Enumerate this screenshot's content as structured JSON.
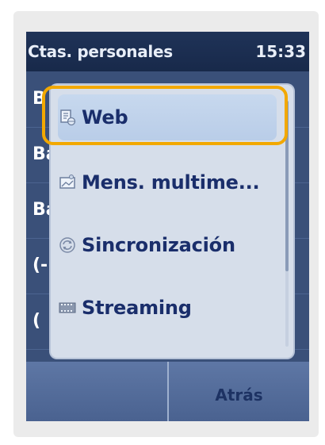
{
  "statusbar": {
    "title": "Ctas. personales",
    "time": "15:33"
  },
  "background_rows": [
    "B",
    "Ba",
    "Ba",
    "(-",
    "("
  ],
  "menu": {
    "items": [
      {
        "label": "Web",
        "icon": "web-page-icon",
        "selected": true
      },
      {
        "label": "Mens. multime...",
        "icon": "multimedia-message-icon",
        "selected": false
      },
      {
        "label": "Sincronización",
        "icon": "sync-icon",
        "selected": false
      },
      {
        "label": "Streaming",
        "icon": "film-strip-icon",
        "selected": false
      }
    ]
  },
  "softkeys": {
    "left": "",
    "right": "Atrás"
  },
  "colors": {
    "highlight": "#f2a800",
    "menu_text": "#1a2e6b",
    "screen_bg": "#2e4266"
  }
}
